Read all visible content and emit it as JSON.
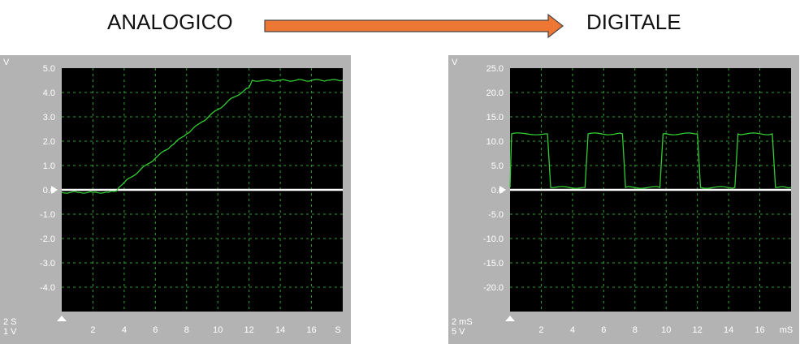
{
  "header": {
    "left_label": "ANALOGICO",
    "right_label": "DIGITALE",
    "arrow_color": "#ee7733"
  },
  "colors": {
    "screen_bg": "#000000",
    "panel_bg": "#b3b3b3",
    "grid": "#2e9e2e",
    "trace": "#33cc33",
    "zero_line": "#ffffff",
    "label_text": "#ffffff"
  },
  "chart_data": [
    {
      "type": "line",
      "title": "",
      "unit_y": "V",
      "unit_x": "S",
      "timebase": "2 S",
      "v_per_div": "1 V",
      "xlim": [
        0,
        18
      ],
      "ylim": [
        -5,
        5
      ],
      "x_ticks": [
        "2",
        "4",
        "6",
        "8",
        "10",
        "12",
        "14",
        "16"
      ],
      "y_ticks": [
        "5.0",
        "4.0",
        "3.0",
        "2.0",
        "1.0",
        "0.0",
        "-1.0",
        "-2.0",
        "-3.0",
        "-4.0"
      ],
      "grid": true,
      "zero_marker": true,
      "series": [
        {
          "x": [
            0,
            1,
            2,
            3,
            3.5,
            4,
            5,
            6,
            7,
            8,
            9,
            10,
            11,
            12,
            12.2,
            13,
            14,
            15,
            16,
            17,
            18
          ],
          "y": [
            -0.1,
            -0.1,
            -0.1,
            -0.1,
            -0.05,
            0.3,
            0.8,
            1.3,
            1.8,
            2.3,
            2.8,
            3.3,
            3.8,
            4.2,
            4.5,
            4.5,
            4.5,
            4.5,
            4.5,
            4.5,
            4.5
          ]
        }
      ]
    },
    {
      "type": "line",
      "title": "",
      "unit_y": "V",
      "unit_x": "mS",
      "timebase": "2 mS",
      "v_per_div": "5 V",
      "xlim": [
        0,
        18
      ],
      "ylim": [
        -25,
        25
      ],
      "x_ticks": [
        "2",
        "4",
        "6",
        "8",
        "10",
        "12",
        "14",
        "16"
      ],
      "y_ticks": [
        "25.0",
        "20.0",
        "15.0",
        "10.0",
        "5.0",
        "0.0",
        "-5.0",
        "-10.0",
        "-15.0",
        "-20.0"
      ],
      "grid": true,
      "zero_marker": true,
      "series": [
        {
          "x": [
            0,
            0.1,
            2.4,
            2.6,
            4.8,
            5.0,
            7.2,
            7.4,
            9.6,
            9.8,
            12.0,
            12.2,
            14.4,
            14.6,
            16.8,
            17.0,
            18
          ],
          "y": [
            0.5,
            11.5,
            11.5,
            0.5,
            0.5,
            11.5,
            11.5,
            0.5,
            0.5,
            11.5,
            11.5,
            0.5,
            0.5,
            11.5,
            11.5,
            0.5,
            0.5
          ]
        }
      ]
    }
  ]
}
